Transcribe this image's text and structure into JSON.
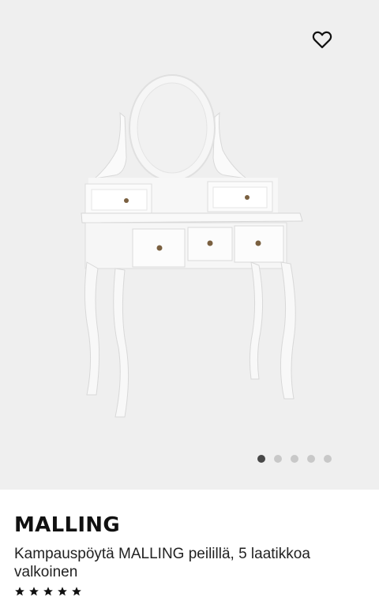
{
  "product": {
    "name": "MALLING",
    "description": "Kampauspöytä MALLING peilillä, 5 laatikkoa valkoinen"
  },
  "gallery": {
    "image_count": 5,
    "active_index": 0,
    "colors": {
      "background": "#efefef",
      "dot_active": "#484848",
      "dot_inactive": "#c8c8c8"
    }
  },
  "icons": {
    "favorite": "heart-outline-icon",
    "rating": "star-icon"
  }
}
